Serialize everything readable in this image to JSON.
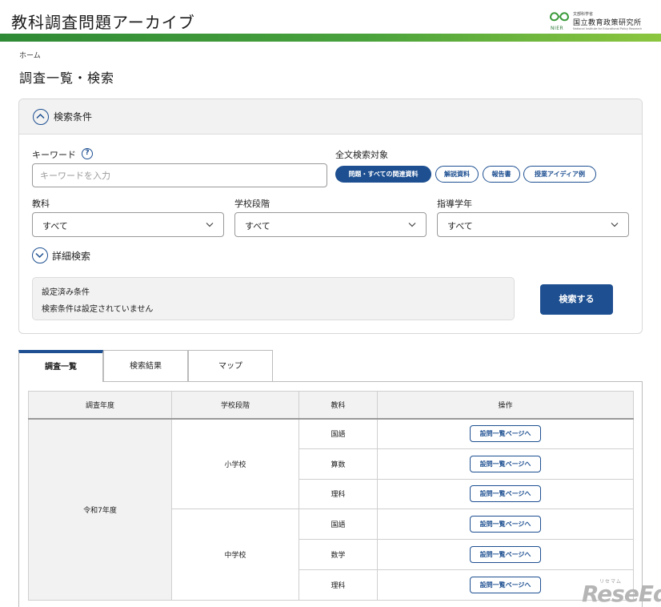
{
  "header": {
    "site_title": "教科調査問題アーカイブ",
    "logo": {
      "sub": "文部科学省",
      "name": "国立教育政策研究所",
      "en": "National Institute for Educational Policy Research",
      "abbr": "NIER"
    }
  },
  "breadcrumb": {
    "home": "ホーム"
  },
  "page_title": "調査一覧・検索",
  "search_panel": {
    "header_label": "検索条件",
    "keyword_label": "キーワード",
    "help_glyph": "?",
    "keyword_placeholder": "キーワードを入力",
    "keyword_value": "",
    "fulltext_label": "全文検索対象",
    "chips": [
      {
        "label": "問題・すべての関連資料",
        "active": true
      },
      {
        "label": "解説資料",
        "active": false
      },
      {
        "label": "報告書",
        "active": false
      },
      {
        "label": "授業アイディア例",
        "active": false
      }
    ],
    "subject_label": "教科",
    "subject_value": "すべて",
    "school_level_label": "学校段階",
    "school_level_value": "すべて",
    "grade_label": "指導学年",
    "grade_value": "すべて",
    "advanced_label": "詳細検索",
    "conditions_title": "設定済み条件",
    "conditions_text": "検索条件は設定されていません",
    "search_button": "検索する"
  },
  "tabs": [
    {
      "label": "調査一覧",
      "active": true
    },
    {
      "label": "検索結果",
      "active": false
    },
    {
      "label": "マップ",
      "active": false
    }
  ],
  "table": {
    "headers": [
      "調査年度",
      "学校段階",
      "教科",
      "操作"
    ],
    "year": "令和7年度",
    "groups": [
      {
        "level": "小学校",
        "subjects": [
          "国語",
          "算数",
          "理科"
        ]
      },
      {
        "level": "中学校",
        "subjects": [
          "国語",
          "数学",
          "理科"
        ]
      }
    ],
    "action_label": "設問一覧ページへ"
  },
  "watermark": {
    "text": "ReseEd",
    "small": "リセマム"
  },
  "colors": {
    "brand_blue": "#1d4f91",
    "brand_green": "#49a23c"
  }
}
